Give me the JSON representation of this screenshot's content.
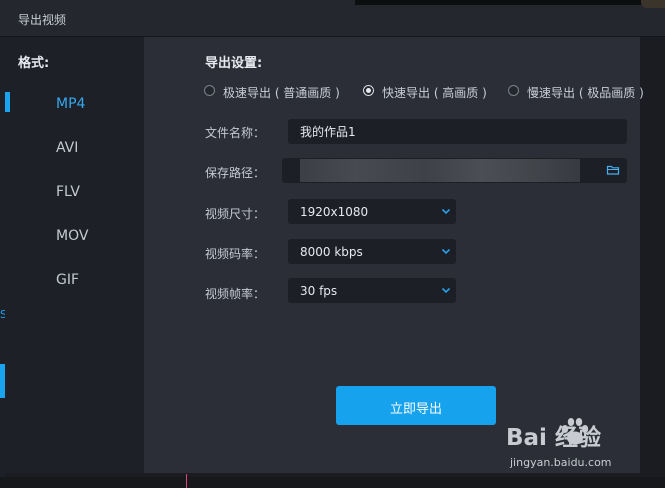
{
  "window": {
    "title": "导出视频"
  },
  "sidebar": {
    "heading": "格式:",
    "formats": [
      "MP4",
      "AVI",
      "FLV",
      "MOV",
      "GIF"
    ],
    "selected_index": 0
  },
  "settings": {
    "heading": "导出设置:",
    "export_modes": [
      {
        "label": "极速导出 ( 普通画质 )",
        "checked": false
      },
      {
        "label": "快速导出 ( 高画质 )",
        "checked": true
      },
      {
        "label": "慢速导出 ( 极品画质 )",
        "checked": false
      }
    ],
    "file_name": {
      "label": "文件名称：",
      "value": "我的作品1"
    },
    "save_path": {
      "label": "保存路径：",
      "value": ""
    },
    "resolution": {
      "label": "视频尺寸：",
      "value": "1920x1080"
    },
    "bitrate": {
      "label": "视频码率：",
      "value": "8000 kbps"
    },
    "framerate": {
      "label": "视频帧率：",
      "value": "30 fps"
    }
  },
  "export_button": {
    "label": "立即导出"
  },
  "watermark": {
    "logo": "Bai  经验",
    "url": "jingyan.baidu.com"
  },
  "colors": {
    "accent": "#1aa3ee",
    "panel": "#2b2e37",
    "sidebar": "#1d2026",
    "input": "#1c1f26"
  }
}
